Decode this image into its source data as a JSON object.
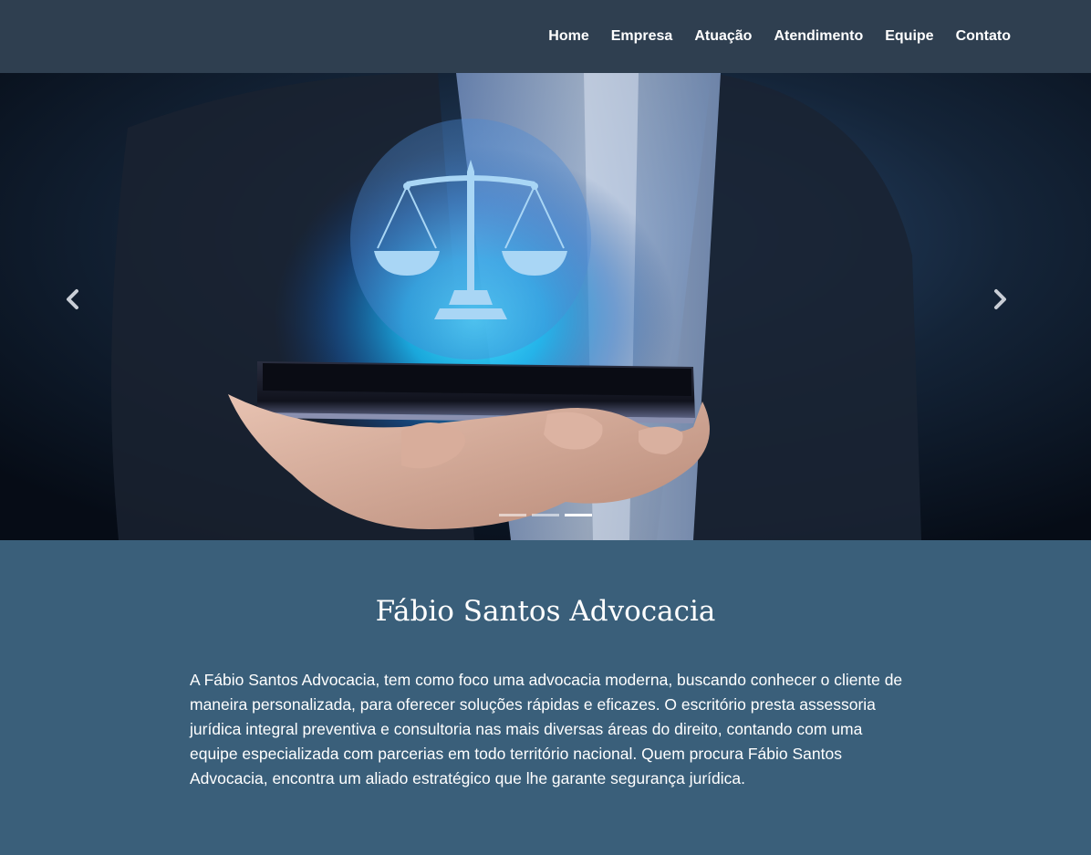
{
  "nav": {
    "items": [
      {
        "label": "Home"
      },
      {
        "label": "Empresa"
      },
      {
        "label": "Atuação"
      },
      {
        "label": "Atendimento"
      },
      {
        "label": "Equipe"
      },
      {
        "label": "Contato"
      }
    ]
  },
  "carousel": {
    "prev_icon": "chevron-left-icon",
    "next_icon": "chevron-right-icon",
    "slide_count": 3,
    "active_slide": 3,
    "hero_image": "hand holding smartphone with glowing scales of justice hologram"
  },
  "about": {
    "title": "Fábio Santos Advocacia",
    "text": "A Fábio Santos Advocacia, tem como foco uma advocacia moderna, buscando conhecer o cliente de maneira personalizada, para oferecer soluções rápidas e eficazes. O escritório presta assessoria jurídica integral preventiva e consultoria nas mais diversas áreas do direito, contando com uma equipe especializada com parcerias em todo território nacional. Quem procura Fábio Santos Advocacia, encontra um aliado estratégico que lhe garante segurança jurídica."
  },
  "colors": {
    "navbar_bg": "#2f3f50",
    "section_bg": "#3a5f7a",
    "text": "#ffffff",
    "glow": "#2fd3f5"
  }
}
